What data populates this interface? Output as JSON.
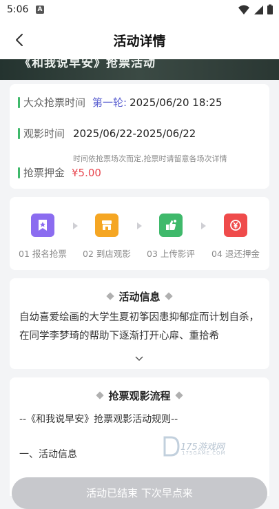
{
  "status_bar": {
    "time": "5:06",
    "notif_letter": "A"
  },
  "header": {
    "title": "活动详情"
  },
  "banner": {
    "text": "《和我说早安》抢票活动"
  },
  "info": {
    "grab_label": "大众抢票时间",
    "round_label": "第一轮:",
    "grab_time": "2025/06/20 18:25",
    "view_label": "观影时间",
    "view_time": "2025/06/22-2025/06/22",
    "view_note": "时间依抢票场次而定,抢票时请留意各场次详情",
    "deposit_label": "抢票押金",
    "deposit_value": "¥5.00"
  },
  "steps": [
    {
      "label": "01 报名抢票",
      "icon": "bookmark-star-icon",
      "color": "#8b6cf0"
    },
    {
      "label": "02 到店观影",
      "icon": "shop-icon",
      "color": "#f5a623"
    },
    {
      "label": "03 上传影评",
      "icon": "thumbs-up-icon",
      "color": "#3fb96b"
    },
    {
      "label": "04 退还押金",
      "icon": "yuan-refund-icon",
      "color": "#ef4b4b"
    }
  ],
  "activity": {
    "heading": "活动信息",
    "text": "自幼喜爱绘画的大学生夏初筝因患抑郁症而计划自杀，在同学李梦琦的帮助下逐渐打开心扉、重拾希"
  },
  "process": {
    "heading": "抢票观影流程",
    "rules_title": "--《和我说早安》抢票观影活动规则--",
    "section1": "一、活动信息"
  },
  "watermark": {
    "text": "175游戏网",
    "sub": "175GAME.COM"
  },
  "bottom_button": {
    "label": "活动已结束 下次早点来"
  }
}
